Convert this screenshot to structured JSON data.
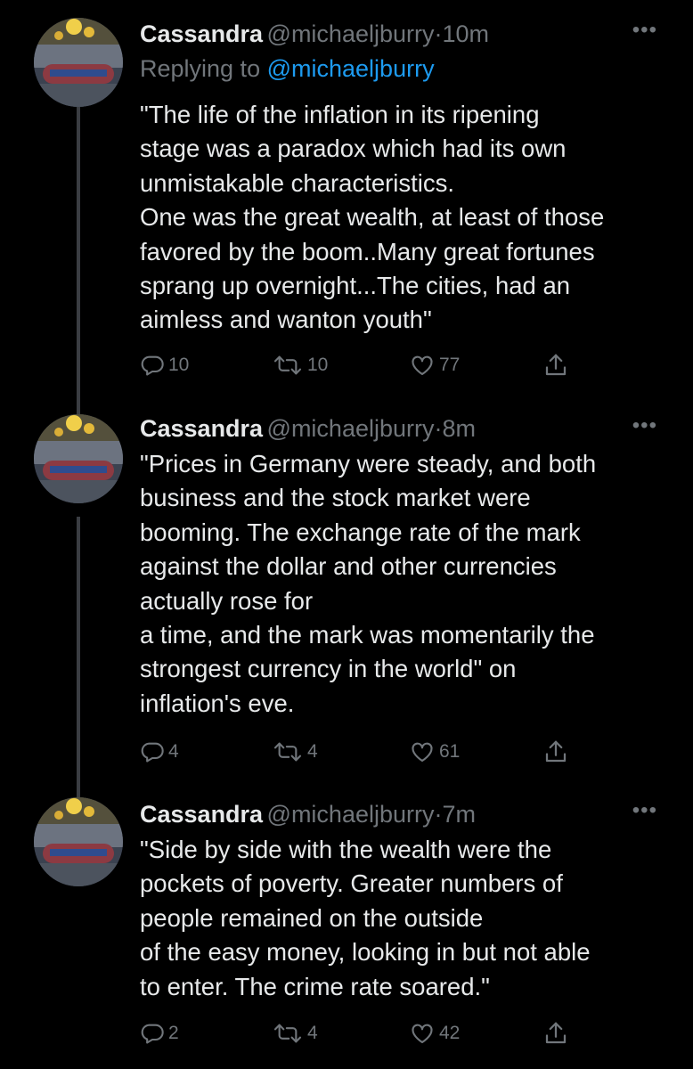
{
  "tweets": [
    {
      "name": "Cassandra",
      "handle": "@michaeljburry",
      "dot": "·",
      "time": "10m",
      "more": "•••",
      "replying_prefix": "Replying to",
      "replying_handle": "@michaeljburry",
      "lines": [
        "\"The life of the inflation in its ripening",
        "stage was a paradox which had its own",
        "unmistakable characteristics.",
        "One was the great wealth, at least of those",
        "favored by the boom..Many great fortunes",
        "sprang up overnight...The cities,  had an",
        "aimless and wanton youth\""
      ],
      "replies": "10",
      "retweets": "10",
      "likes": "77"
    },
    {
      "name": "Cassandra",
      "handle": "@michaeljburry",
      "dot": "·",
      "time": "8m",
      "more": "•••",
      "lines": [
        "\"Prices in Germany were steady, and both",
        "business and the stock market were",
        "booming. The exchange rate of the mark",
        "against the dollar and other currencies",
        "actually rose for",
        "a time, and the mark was momentarily the",
        "strongest currency in the world\" on",
        "inflation's eve."
      ],
      "replies": "4",
      "retweets": "4",
      "likes": "61"
    },
    {
      "name": "Cassandra",
      "handle": "@michaeljburry",
      "dot": "·",
      "time": "7m",
      "more": "•••",
      "lines": [
        "\"Side by side with the wealth were the",
        "pockets of poverty. Greater numbers of",
        "people remained on the outside",
        "of the easy money, looking in but not able",
        "to enter. The crime rate soared.\""
      ],
      "replies": "2",
      "retweets": "4",
      "likes": "42"
    }
  ],
  "colors": {
    "background": "#000000",
    "text": "#e7e9ea",
    "secondary": "#71767b",
    "link": "#1d9bf0",
    "thread_line": "#3a3d42"
  },
  "icons": [
    "reply-icon",
    "retweet-icon",
    "like-icon",
    "share-icon",
    "more-icon"
  ]
}
